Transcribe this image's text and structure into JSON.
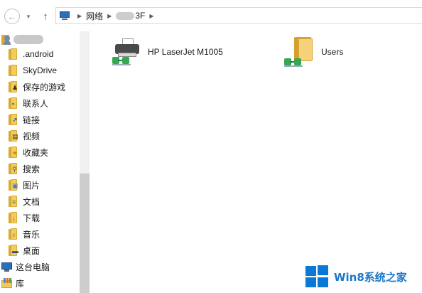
{
  "address_bar": {
    "back_glyph": "←",
    "dropdown_glyph": "▼",
    "up_glyph": "↑",
    "separator_glyph": "▶",
    "crumbs": [
      "网络",
      "3F"
    ]
  },
  "nav_pane": {
    "items": [
      {
        "label": ".android",
        "icon": "folder-icon"
      },
      {
        "label": "SkyDrive",
        "icon": "folder-icon"
      },
      {
        "label": "保存的游戏",
        "icon": "saved-games-folder-icon"
      },
      {
        "label": "联系人",
        "icon": "contacts-folder-icon"
      },
      {
        "label": "链接",
        "icon": "links-folder-icon"
      },
      {
        "label": "视频",
        "icon": "videos-folder-icon"
      },
      {
        "label": "收藏夹",
        "icon": "favorites-folder-icon"
      },
      {
        "label": "搜索",
        "icon": "searches-folder-icon"
      },
      {
        "label": "图片",
        "icon": "pictures-folder-icon"
      },
      {
        "label": "文档",
        "icon": "documents-folder-icon"
      },
      {
        "label": "下载",
        "icon": "downloads-folder-icon"
      },
      {
        "label": "音乐",
        "icon": "music-folder-icon"
      },
      {
        "label": "桌面",
        "icon": "desktop-folder-icon"
      }
    ],
    "this_pc_label": "这台电脑",
    "libraries_label": "库"
  },
  "content": {
    "items": [
      {
        "label": "HP LaserJet M1005",
        "icon": "shared-printer-icon"
      },
      {
        "label": "Users",
        "icon": "shared-folder-icon"
      }
    ]
  },
  "watermark": {
    "text": "Win8系统之家"
  },
  "colors": {
    "win_blue": "#0a78d4",
    "folder_yellow": "#f3cd5b",
    "share_green": "#34a853"
  }
}
